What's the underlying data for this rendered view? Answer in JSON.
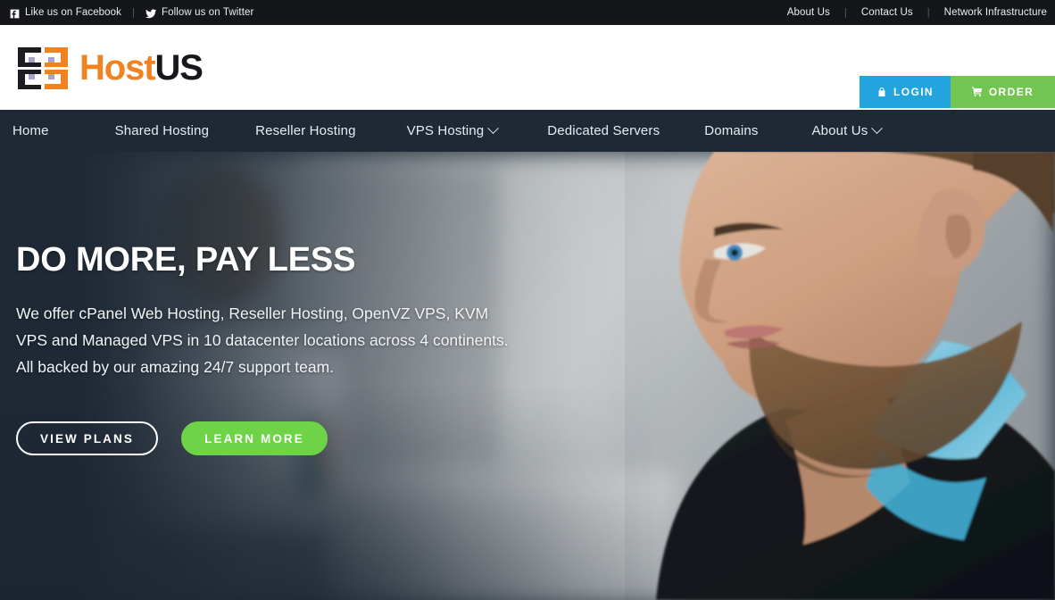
{
  "topbar": {
    "social": [
      {
        "icon": "facebook-icon",
        "label": "Like us on Facebook"
      },
      {
        "icon": "twitter-icon",
        "label": "Follow us on Twitter"
      }
    ],
    "separator": "|",
    "links": [
      {
        "label": "About Us"
      },
      {
        "label": "Contact Us"
      },
      {
        "label": "Network Infrastructure"
      }
    ],
    "background": "#14161a",
    "text_color": "#e9eaec"
  },
  "header": {
    "logo": {
      "icon": "server-rack-icon",
      "text_primary": "Host",
      "text_secondary": "US",
      "primary_color": "#f08222",
      "secondary_color": "#16181c"
    },
    "buttons": [
      {
        "id": "login",
        "icon": "lock-icon",
        "label": "LOGIN",
        "color": "#23a4df"
      },
      {
        "id": "order",
        "icon": "cart-icon",
        "label": "ORDER",
        "color": "#74c452"
      }
    ]
  },
  "nav": {
    "background": "#1e2935",
    "items": [
      {
        "label": "Home",
        "has_dropdown": false
      },
      {
        "label": "Shared Hosting",
        "has_dropdown": false
      },
      {
        "label": "Reseller Hosting",
        "has_dropdown": false
      },
      {
        "label": "VPS Hosting",
        "has_dropdown": true
      },
      {
        "label": "Dedicated Servers",
        "has_dropdown": false
      },
      {
        "label": "Domains",
        "has_dropdown": false
      },
      {
        "label": "About Us",
        "has_dropdown": true
      }
    ]
  },
  "hero": {
    "title": "DO MORE, PAY LESS",
    "subtitle": "We offer cPanel Web Hosting, Reseller Hosting, OpenVZ VPS, KVM VPS and Managed VPS in 10 datacenter locations across 4 continents. All backed by our amazing 24/7 support team.",
    "buttons": [
      {
        "id": "view-plans",
        "label": "VIEW PLANS",
        "style": "outline"
      },
      {
        "id": "learn-more",
        "label": "LEARN MORE",
        "style": "solid",
        "color": "#6ed347"
      }
    ],
    "background_image_description": "Blurred office photo of a bearded man in profile wearing a light blue collared shirt and dark jacket",
    "overlay_color": "#1e2935"
  }
}
